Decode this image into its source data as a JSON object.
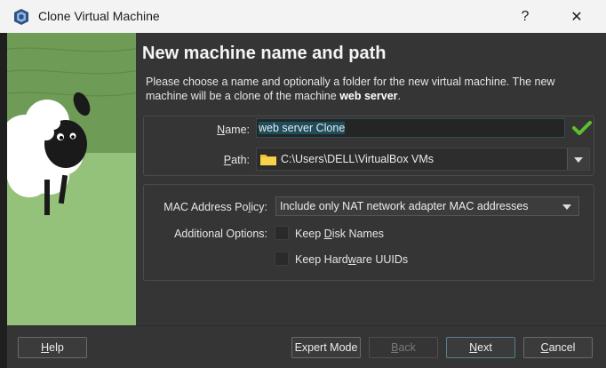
{
  "window": {
    "title": "Clone Virtual Machine",
    "help_glyph": "?",
    "close_glyph": "✕",
    "app_icon": "virtualbox-icon"
  },
  "page": {
    "heading": "New machine name and path",
    "description_prefix": "Please choose a name and optionally a folder for the new virtual machine. The new machine will be a clone of the machine ",
    "source_machine": "web server",
    "description_suffix": "."
  },
  "form": {
    "name_label_u": "N",
    "name_label_rest": "ame:",
    "name_value": "web server Clone",
    "name_valid_icon": "check-icon",
    "path_label_u": "P",
    "path_label_rest": "ath:",
    "path_value": "C:\\Users\\DELL\\VirtualBox VMs",
    "mac_label_pre": "MAC Address Po",
    "mac_label_u": "l",
    "mac_label_post": "icy:",
    "mac_value": "Include only NAT network adapter MAC addresses",
    "additional_label": "Additional Options:",
    "keep_disk_pre": "Keep ",
    "keep_disk_u": "D",
    "keep_disk_post": "isk Names",
    "keep_disk_checked": false,
    "keep_hw_pre": "Keep Hard",
    "keep_hw_u": "w",
    "keep_hw_post": "are UUIDs",
    "keep_hw_checked": false
  },
  "buttons": {
    "help_u": "H",
    "help_rest": "elp",
    "expert": "Expert Mode",
    "back_u": "B",
    "back_rest": "ack",
    "next_u": "N",
    "next_rest": "ext",
    "cancel_u": "C",
    "cancel_rest": "ancel"
  },
  "colors": {
    "accent_check": "#5fbf2e",
    "folder": "#f2c230",
    "art_background": "#6e9b56"
  }
}
